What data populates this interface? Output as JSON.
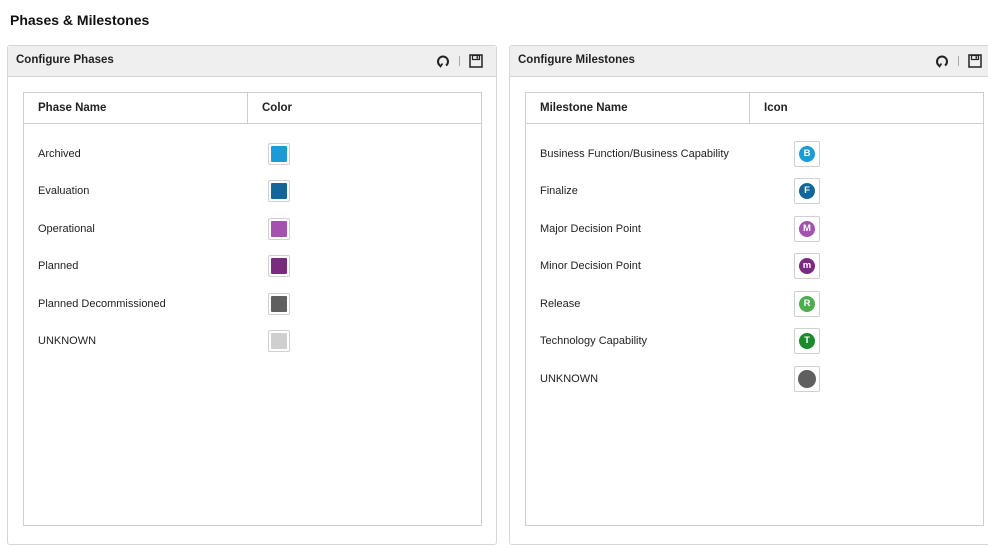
{
  "page_title": "Phases & Milestones",
  "phases_panel": {
    "title": "Configure Phases",
    "tools": [
      "refresh-icon",
      "save-icon"
    ],
    "columns": [
      "Phase Name",
      "Color"
    ],
    "rows": [
      {
        "name": "Archived",
        "color": "#1a9ad6"
      },
      {
        "name": "Evaluation",
        "color": "#13669a"
      },
      {
        "name": "Operational",
        "color": "#a352ad"
      },
      {
        "name": "Planned",
        "color": "#7a2a7f"
      },
      {
        "name": "Planned Decommissioned",
        "color": "#5f5f5f"
      },
      {
        "name": "UNKNOWN",
        "color": "#cfcfcf"
      }
    ]
  },
  "milestones_panel": {
    "title": "Configure Milestones",
    "tools": [
      "refresh-icon",
      "save-icon"
    ],
    "columns": [
      "Milestone Name",
      "Icon"
    ],
    "rows": [
      {
        "name": "Business Function/Business Capability",
        "icon_letter": "B",
        "color": "#1a9ad6"
      },
      {
        "name": "Finalize",
        "icon_letter": "F",
        "color": "#13669a"
      },
      {
        "name": "Major Decision Point",
        "icon_letter": "M",
        "color": "#a352ad"
      },
      {
        "name": "Minor Decision Point",
        "icon_letter": "m",
        "color": "#7a2a7f"
      },
      {
        "name": "Release",
        "icon_letter": "R",
        "color": "#4cae4c"
      },
      {
        "name": "Technology Capability",
        "icon_letter": "T",
        "color": "#1b8a2c"
      },
      {
        "name": "UNKNOWN",
        "icon_letter": "",
        "color": "#5f5f5f"
      }
    ]
  }
}
